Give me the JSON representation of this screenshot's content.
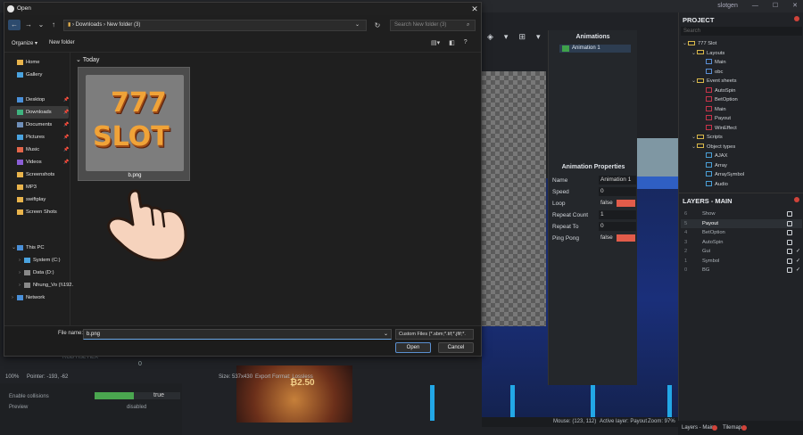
{
  "editor": {
    "user": "slotgen",
    "animations_title": "Animations",
    "animation_item": "Animation 1",
    "anim_props_title": "Animation Properties",
    "anim_props": [
      {
        "key": "Name",
        "value": "Animation 1",
        "type": "text"
      },
      {
        "key": "Speed",
        "value": "0",
        "type": "text"
      },
      {
        "key": "Loop",
        "value": "false",
        "type": "bool"
      },
      {
        "key": "Repeat Count",
        "value": "1",
        "type": "text"
      },
      {
        "key": "Repeat To",
        "value": "0",
        "type": "text"
      },
      {
        "key": "Ping Pong",
        "value": "false",
        "type": "bool"
      }
    ],
    "status_zoom": "100%",
    "status_pointer": "Pointer: -193, -62",
    "status_size": "Size: 537x430",
    "status_export": "Export Format: Lossless",
    "color_mode_links": "RGB   HSL   HEX",
    "ghost_zero": "0",
    "enable_collisions_label": "Enable collisions",
    "enable_collisions_value": "true",
    "preview_label": "Preview",
    "preview_value": "disabled",
    "game_text": "₿2.50",
    "mouse_readout": "Mouse: (123, 112)",
    "active_layer": "Active layer: Payout",
    "zoom_readout": "Zoom: 97%"
  },
  "project": {
    "title": "PROJECT",
    "search_placeholder": "Search",
    "tree": [
      {
        "depth": 0,
        "kind": "folder",
        "label": "777 Slot"
      },
      {
        "depth": 1,
        "kind": "folder",
        "label": "Layouts"
      },
      {
        "depth": 2,
        "kind": "layout",
        "label": "Main"
      },
      {
        "depth": 2,
        "kind": "layout",
        "label": "obc"
      },
      {
        "depth": 1,
        "kind": "folder",
        "label": "Event sheets"
      },
      {
        "depth": 2,
        "kind": "event",
        "label": "AutoSpin"
      },
      {
        "depth": 2,
        "kind": "event",
        "label": "BetOption"
      },
      {
        "depth": 2,
        "kind": "event",
        "label": "Main"
      },
      {
        "depth": 2,
        "kind": "event",
        "label": "Payout"
      },
      {
        "depth": 2,
        "kind": "event",
        "label": "WinEffect"
      },
      {
        "depth": 1,
        "kind": "folder",
        "label": "Scripts"
      },
      {
        "depth": 1,
        "kind": "folder",
        "label": "Object types"
      },
      {
        "depth": 2,
        "kind": "object",
        "label": "AJAX"
      },
      {
        "depth": 2,
        "kind": "object",
        "label": "Array"
      },
      {
        "depth": 2,
        "kind": "object",
        "label": "ArraySymbol"
      },
      {
        "depth": 2,
        "kind": "object",
        "label": "Audio"
      }
    ]
  },
  "layers": {
    "title": "LAYERS - MAIN",
    "items": [
      {
        "num": "6",
        "label": "Show",
        "checked": false,
        "selected": false
      },
      {
        "num": "5",
        "label": "Payout",
        "checked": false,
        "selected": true
      },
      {
        "num": "4",
        "label": "BetOption",
        "checked": false,
        "selected": false
      },
      {
        "num": "3",
        "label": "AutoSpin",
        "checked": false,
        "selected": false
      },
      {
        "num": "2",
        "label": "Gui",
        "checked": true,
        "selected": false
      },
      {
        "num": "1",
        "label": "Symbol",
        "checked": true,
        "selected": false
      },
      {
        "num": "0",
        "label": "BG",
        "checked": true,
        "selected": false
      }
    ],
    "tab_layers": "Layers - Main",
    "tab_tilemap": "Tilemap"
  },
  "dialog": {
    "title": "Open",
    "path": [
      "Downloads",
      "New folder (3)"
    ],
    "search_placeholder": "Search New folder (3)",
    "organize_label": "Organize ▾",
    "new_folder_label": "New folder",
    "nav_items": [
      {
        "label": "Home",
        "icon": "home-icon",
        "color": "#e9b44c",
        "pin": false,
        "sel": false,
        "expander": ""
      },
      {
        "label": "Gallery",
        "icon": "gallery-icon",
        "color": "#4aa3df",
        "pin": false,
        "sel": false,
        "expander": ""
      },
      {
        "label": "Desktop",
        "icon": "desktop-icon",
        "color": "#4a90d9",
        "pin": true,
        "sel": false,
        "expander": ""
      },
      {
        "label": "Downloads",
        "icon": "download-icon",
        "color": "#3fb37f",
        "pin": true,
        "sel": true,
        "expander": ""
      },
      {
        "label": "Documents",
        "icon": "documents-icon",
        "color": "#6f8fb9",
        "pin": true,
        "sel": false,
        "expander": ""
      },
      {
        "label": "Pictures",
        "icon": "pictures-icon",
        "color": "#4aa3df",
        "pin": true,
        "sel": false,
        "expander": ""
      },
      {
        "label": "Music",
        "icon": "music-icon",
        "color": "#e4664a",
        "pin": true,
        "sel": false,
        "expander": ""
      },
      {
        "label": "Videos",
        "icon": "videos-icon",
        "color": "#8b5ed6",
        "pin": true,
        "sel": false,
        "expander": ""
      },
      {
        "label": "Screenshots",
        "icon": "folder-icon",
        "color": "#e9b44c",
        "pin": false,
        "sel": false,
        "expander": ""
      },
      {
        "label": "MP3",
        "icon": "folder-icon",
        "color": "#e9b44c",
        "pin": false,
        "sel": false,
        "expander": ""
      },
      {
        "label": "swiftplay",
        "icon": "folder-icon",
        "color": "#e9b44c",
        "pin": false,
        "sel": false,
        "expander": ""
      },
      {
        "label": "Screen Shots",
        "icon": "folder-icon",
        "color": "#e9b44c",
        "pin": false,
        "sel": false,
        "expander": ""
      },
      {
        "label": "This PC",
        "icon": "pc-icon",
        "color": "#4a90d9",
        "pin": false,
        "sel": false,
        "expander": "⌄"
      },
      {
        "label": "System (C:)",
        "icon": "drive-icon",
        "color": "#4aa3df",
        "pin": false,
        "sel": false,
        "expander": "›"
      },
      {
        "label": "Data (D:)",
        "icon": "drive-icon",
        "color": "#888888",
        "pin": false,
        "sel": false,
        "expander": "›"
      },
      {
        "label": "Nhung_Vo (\\\\192.",
        "icon": "network-drive-icon",
        "color": "#888888",
        "pin": false,
        "sel": false,
        "expander": "›"
      },
      {
        "label": "Network",
        "icon": "network-icon",
        "color": "#4a90d9",
        "pin": false,
        "sel": false,
        "expander": "›"
      }
    ],
    "group_label": "Today",
    "file_name": "b.png",
    "file_name_label": "File name:",
    "file_name_value": "b.png",
    "filter_value": "Custom Files (*.sbm;*.tif;*.jfif;*.",
    "open_label": "Open",
    "cancel_label": "Cancel",
    "thumb_line1": "777",
    "thumb_line2": "SLOT"
  }
}
